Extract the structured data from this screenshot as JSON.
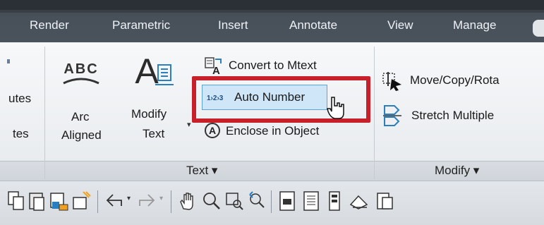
{
  "tabs": [
    "Render",
    "Parametric",
    "Insert",
    "Annotate",
    "View",
    "Manage"
  ],
  "left_clipped": [
    "utes",
    "tes"
  ],
  "arc_aligned": {
    "icon_text": "ABC",
    "line1": "Arc",
    "line2": "Aligned"
  },
  "modify_text": {
    "icon_text": "A",
    "line1": "Modify",
    "line2": "Text"
  },
  "text_commands": {
    "convert": "Convert to Mtext",
    "auto_number_icon": "1›2›3",
    "auto_number": "Auto Number",
    "enclose_icon": "A",
    "enclose": "Enclose in Object"
  },
  "modify_commands": {
    "move": "Move/Copy/Rota",
    "stretch": "Stretch Multiple"
  },
  "panels": {
    "text": "Text ▾",
    "modify": "Modify ▾"
  },
  "colors": {
    "highlight": "#c8202a",
    "selection": "#cfe6f8",
    "tab_bar": "#475059"
  },
  "toolbar_icons": [
    "copy-icon",
    "paste-icon",
    "match-properties-icon",
    "paste-special-icon",
    "undo-icon",
    "redo-icon",
    "pan-icon",
    "zoom-realtime-icon",
    "zoom-window-icon",
    "zoom-previous-icon",
    "properties-icon",
    "design-center-icon",
    "tool-palettes-icon",
    "sheet-set-icon",
    "markup-icon"
  ]
}
